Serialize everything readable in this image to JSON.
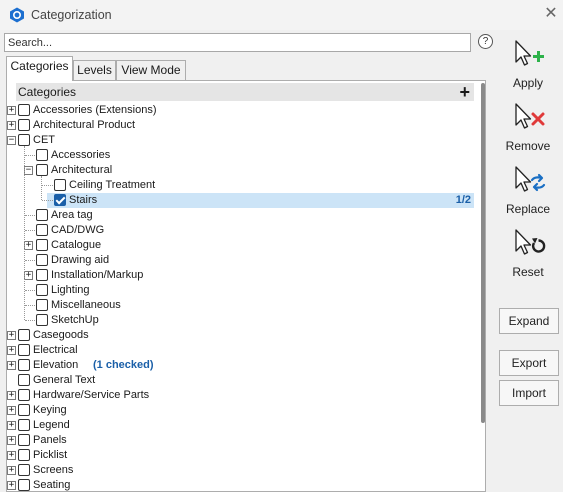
{
  "window": {
    "title": "Categorization"
  },
  "search": {
    "placeholder": "Search..."
  },
  "help": {
    "label": "?"
  },
  "tabs": [
    {
      "label": "Categories",
      "active": true
    },
    {
      "label": "Levels",
      "active": false
    },
    {
      "label": "View Mode",
      "active": false
    }
  ],
  "tree": {
    "header": "Categories",
    "add_label": "+",
    "rows": [
      {
        "label": "Accessories (Extensions)",
        "level": 0,
        "expander": "+",
        "checked": false
      },
      {
        "label": "Architectural Product",
        "level": 0,
        "expander": "+",
        "checked": false
      },
      {
        "label": "CET",
        "level": 0,
        "expander": "−",
        "checked": false
      },
      {
        "label": "Accessories",
        "level": 1,
        "expander": "",
        "checked": false
      },
      {
        "label": "Architectural",
        "level": 1,
        "expander": "−",
        "checked": false
      },
      {
        "label": "Ceiling Treatment",
        "level": 2,
        "expander": "",
        "checked": false
      },
      {
        "label": "Stairs",
        "level": 2,
        "expander": "",
        "checked": true,
        "selected": true,
        "ratio": "1/2"
      },
      {
        "label": "Area tag",
        "level": 1,
        "expander": "",
        "checked": false
      },
      {
        "label": "CAD/DWG",
        "level": 1,
        "expander": "",
        "checked": false
      },
      {
        "label": "Catalogue",
        "level": 1,
        "expander": "+",
        "checked": false
      },
      {
        "label": "Drawing aid",
        "level": 1,
        "expander": "",
        "checked": false
      },
      {
        "label": "Installation/Markup",
        "level": 1,
        "expander": "+",
        "checked": false
      },
      {
        "label": "Lighting",
        "level": 1,
        "expander": "",
        "checked": false
      },
      {
        "label": "Miscellaneous",
        "level": 1,
        "expander": "",
        "checked": false
      },
      {
        "label": "SketchUp",
        "level": 1,
        "expander": "",
        "checked": false
      },
      {
        "label": "Casegoods",
        "level": 0,
        "expander": "+",
        "checked": false
      },
      {
        "label": "Electrical",
        "level": 0,
        "expander": "+",
        "checked": false
      },
      {
        "label": "Elevation",
        "level": 0,
        "expander": "+",
        "checked": false,
        "extra": "(1 checked)"
      },
      {
        "label": "General Text",
        "level": 0,
        "expander": "",
        "checked": false
      },
      {
        "label": "Hardware/Service Parts",
        "level": 0,
        "expander": "+",
        "checked": false
      },
      {
        "label": "Keying",
        "level": 0,
        "expander": "+",
        "checked": false
      },
      {
        "label": "Legend",
        "level": 0,
        "expander": "+",
        "checked": false
      },
      {
        "label": "Panels",
        "level": 0,
        "expander": "+",
        "checked": false
      },
      {
        "label": "Picklist",
        "level": 0,
        "expander": "+",
        "checked": false
      },
      {
        "label": "Screens",
        "level": 0,
        "expander": "+",
        "checked": false
      },
      {
        "label": "Seating",
        "level": 0,
        "expander": "+",
        "checked": false
      }
    ]
  },
  "actions": {
    "apply": {
      "label": "Apply",
      "icon": "cursor-plus-icon",
      "color": "#2db24a"
    },
    "remove": {
      "label": "Remove",
      "icon": "cursor-x-icon",
      "color": "#e03a3a"
    },
    "replace": {
      "label": "Replace",
      "icon": "cursor-swap-icon",
      "color": "#1a6fc4"
    },
    "reset": {
      "label": "Reset",
      "icon": "cursor-undo-icon",
      "color": "#222222"
    }
  },
  "buttons": {
    "expand": "Expand",
    "export": "Export",
    "import": "Import"
  },
  "colors": {
    "accent": "#1a5fa8",
    "selection": "#cce4f7",
    "header_bg": "#e5e5e5"
  }
}
